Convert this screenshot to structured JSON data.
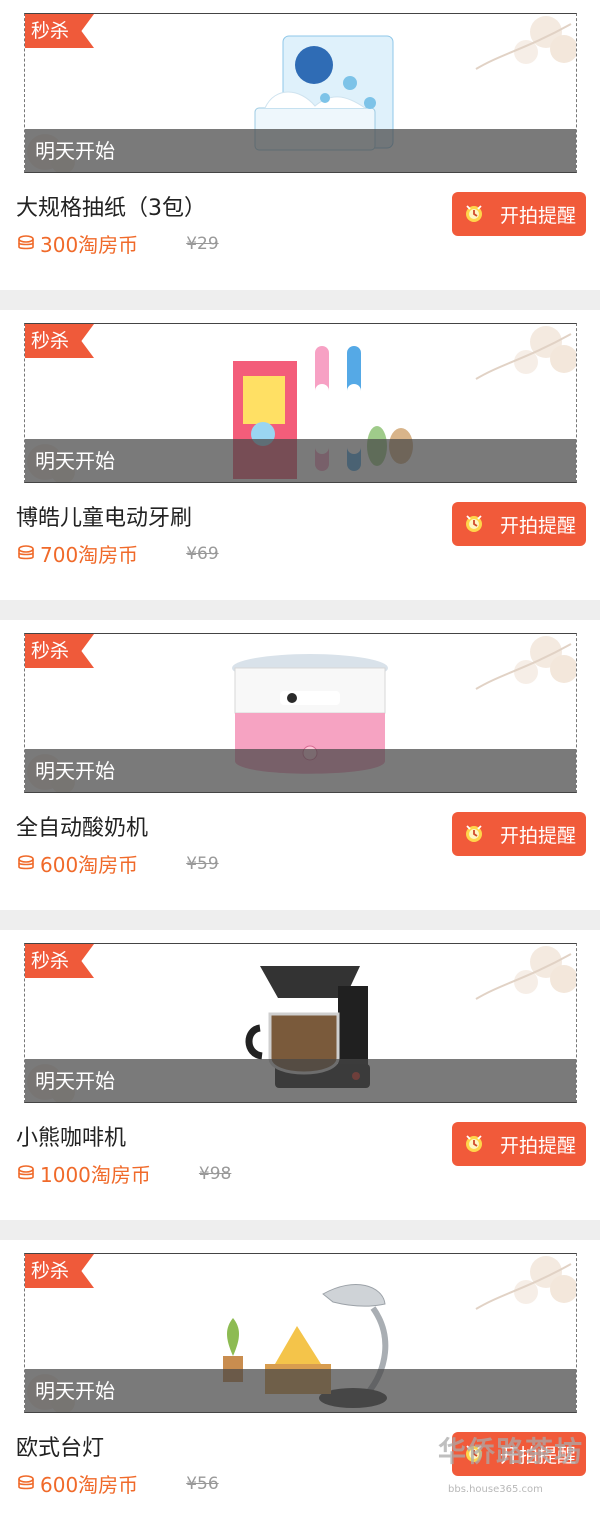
{
  "colors": {
    "accent": "#f15a3a",
    "coins": "#f06a2a",
    "divider": "#eeeeee",
    "overlay": "#4a4a4a"
  },
  "products": [
    {
      "badge": "秒杀",
      "status": "明天开始",
      "name": "大规格抽纸（3包）",
      "coins": "300淘房币",
      "old_price": "¥29",
      "button": "开拍提醒",
      "icon": "tissue-box-icon"
    },
    {
      "badge": "秒杀",
      "status": "明天开始",
      "name": "博皓儿童电动牙刷",
      "coins": "700淘房币",
      "old_price": "¥69",
      "button": "开拍提醒",
      "icon": "toothbrush-icon"
    },
    {
      "badge": "秒杀",
      "status": "明天开始",
      "name": "全自动酸奶机",
      "coins": "600淘房币",
      "old_price": "¥59",
      "button": "开拍提醒",
      "icon": "yogurt-maker-icon"
    },
    {
      "badge": "秒杀",
      "status": "明天开始",
      "name": "小熊咖啡机",
      "coins": "1000淘房币",
      "old_price": "¥98",
      "button": "开拍提醒",
      "icon": "coffee-maker-icon"
    },
    {
      "badge": "秒杀",
      "status": "明天开始",
      "name": "欧式台灯",
      "coins": "600淘房币",
      "old_price": "¥56",
      "button": "开拍提醒",
      "icon": "desk-lamp-icon"
    }
  ],
  "watermark": {
    "text": "华侨路茶坊",
    "subtext": "bbs.house365.com"
  }
}
